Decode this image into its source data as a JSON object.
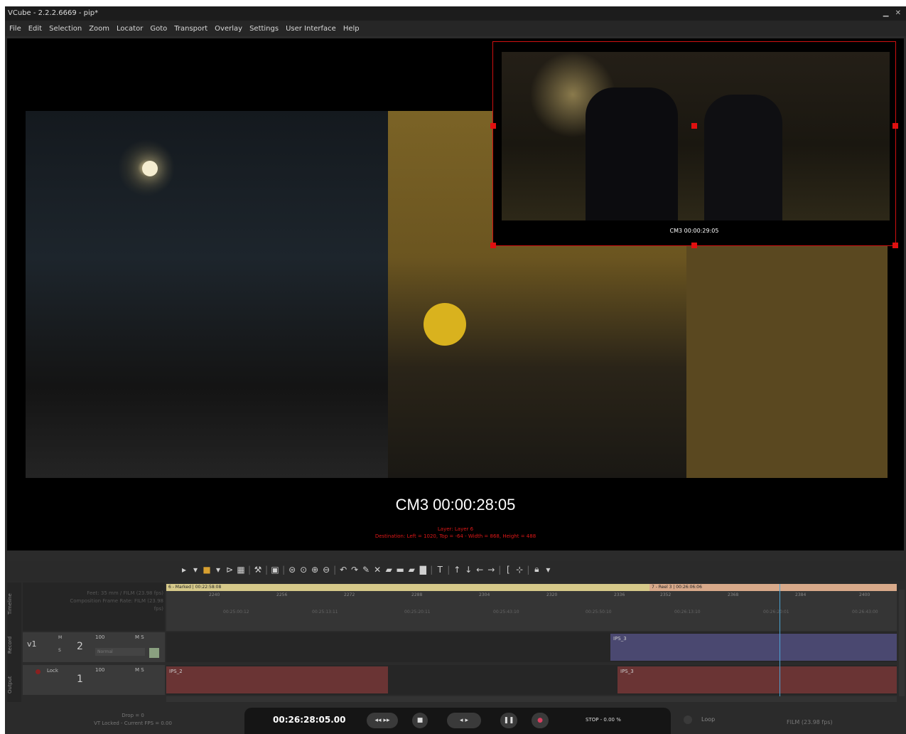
{
  "window": {
    "title": "VCube - 2.2.2.6669 - pip*",
    "controls": "▁ ✕"
  },
  "menu": [
    "File",
    "Edit",
    "Selection",
    "Zoom",
    "Locator",
    "Goto",
    "Transport",
    "Overlay",
    "Settings",
    "User Interface",
    "Help"
  ],
  "viewer": {
    "main_timecode": "CM3 00:00:28:05",
    "pip_timecode": "CM3 00:00:29:05",
    "overlay_layer": "Layer: Layer 6",
    "overlay_destination": "Destination: Left = 1020, Top = -64 - Width = 868, Height = 488"
  },
  "toolbar": {
    "icons": [
      "folder-icon",
      "marker-icon",
      "play-split-icon",
      "grid-icon",
      "tools-icon",
      "save-icon",
      "zoom-fit-icon",
      "zoom-reset-icon",
      "zoom-in-icon",
      "zoom-out-icon",
      "undo-icon",
      "redo-icon",
      "pencil-icon",
      "cut-icon",
      "eraser-icon",
      "insert-icon",
      "overwrite-icon",
      "fill-icon",
      "text-icon",
      "arrow-up-icon",
      "arrow-down-icon",
      "arrow-left-icon",
      "arrow-right-icon",
      "bracket-icon",
      "split-icon",
      "lock-icon"
    ],
    "glyphs": {
      "folder": "▸",
      "marker": "■",
      "play": "⊳",
      "grid": "▦",
      "tools": "⚒",
      "save": "▣",
      "zoomfit": "⊜",
      "zoomreset": "⊙",
      "zoomin": "⊕",
      "zoomout": "⊖",
      "undo": "↶",
      "redo": "↷",
      "pencil": "✎",
      "cut": "✕",
      "eraser": "▰",
      "insert": "▬",
      "overwrite": "▰",
      "fill": "▇",
      "text": "T",
      "up": "↑",
      "down": "↓",
      "left": "←",
      "right": "→",
      "bracket": "[",
      "split": "⊹",
      "lock": "🔒︎",
      "sep": "|",
      "dd": "▾"
    }
  },
  "timeline": {
    "side_tabs": [
      "Timeline",
      "Record",
      "Output"
    ],
    "info_line1": "Feet: 35 mm / FILM (23.98 fps)",
    "info_line2": "Composition Frame Rate: FILM (23.98",
    "info_line3": "fps)",
    "reels": [
      {
        "label": "6 - Marked | 00:22:58:08"
      },
      {
        "label": "7 - Reel 3 | 00:26:06:06"
      }
    ],
    "ticks": [
      "2240",
      "2256",
      "2272",
      "2288",
      "2304",
      "2320",
      "2336",
      "2352",
      "2368",
      "2384",
      "2400"
    ],
    "tc_labels": [
      "00:25:00:12",
      "00:25:13:11",
      "00:25:20:11",
      "00:25:43:10",
      "00:25:50:10",
      "00:26:13:10",
      "00:26:20:01",
      "00:26:43:00"
    ],
    "tracks": [
      {
        "name": "v1",
        "number": "2",
        "percent": "100",
        "mode": "Normal",
        "m": "M",
        "s": "S",
        "clips": [
          {
            "label": "IPS_3",
            "color": "#4a4870"
          }
        ]
      },
      {
        "lock": "Lock",
        "number": "1",
        "percent": "100",
        "m": "M",
        "s": "S",
        "clips": [
          {
            "label": "IPS_2",
            "color": "#6a3434"
          },
          {
            "label": "IPS_3",
            "color": "#6a3434"
          }
        ]
      }
    ]
  },
  "transport": {
    "timecode": "00:26:28:05.00",
    "status": "STOP - 0.00 %",
    "buttons": {
      "rewind": "◂◂",
      "ffwd": "▸▸",
      "stop": "■",
      "prev": "◂",
      "next": "▸",
      "pause": "❚❚",
      "record": "●"
    },
    "drop": "Drop = 0",
    "vt_status": "VT Locked - Current FPS = 0.00",
    "loop_label": "Loop",
    "fps_label": "FILM (23.98 fps)"
  },
  "colors": {
    "reel1": "#d6c98a",
    "reel2": "#d8a98a",
    "pip_border": "#d01010",
    "overlay_text": "#e01818",
    "playhead": "#4ba4d4"
  }
}
